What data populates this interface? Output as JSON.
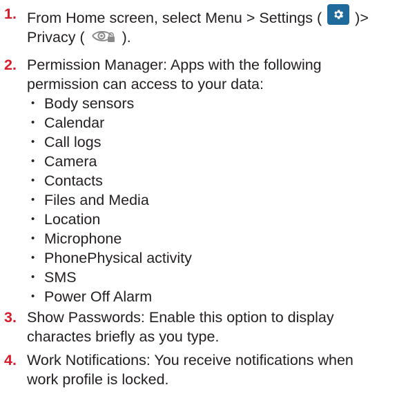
{
  "steps": [
    {
      "number": "1.",
      "line1_before": "From Home screen, select Menu > Settings (",
      "line1_after": ")>",
      "line2_before": "Privacy (",
      "line2_after": ")."
    },
    {
      "number": "2.",
      "line1": "Permission Manager: Apps with the following",
      "line2": "permission can access to your data:",
      "bullets": [
        "Body sensors",
        "Calendar",
        "Call logs",
        "Camera",
        "Contacts",
        "Files and Media",
        "Location",
        "Microphone",
        "PhonePhysical activity",
        "SMS",
        "Power Off Alarm"
      ]
    },
    {
      "number": "3.",
      "line1": "Show Passwords: Enable this option to display",
      "line2": "charactes briefly as you type."
    },
    {
      "number": "4.",
      "line1": "Work Notifications: You receive notifications when",
      "line2": "work profile is locked."
    }
  ],
  "icons": {
    "settings": "settings-gear-icon",
    "privacy": "privacy-eye-icon"
  },
  "colors": {
    "step_number": "#d81b2a",
    "settings_icon_bg": "#1e6a9a",
    "text": "#231f20"
  }
}
